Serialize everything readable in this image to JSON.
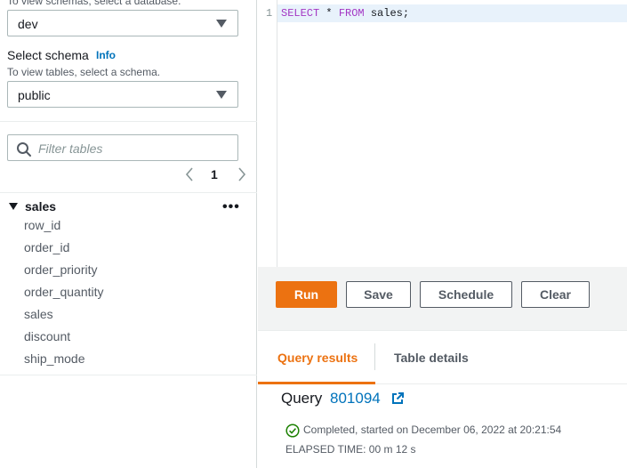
{
  "database": {
    "hint": "To view schemas, select a database.",
    "value": "dev"
  },
  "schema": {
    "label": "Select schema",
    "info": "Info",
    "hint": "To view tables, select a schema.",
    "value": "public"
  },
  "tables": {
    "filter_placeholder": "Filter tables",
    "page": "1",
    "tree": {
      "name": "sales",
      "columns": [
        "row_id",
        "order_id",
        "order_priority",
        "order_quantity",
        "sales",
        "discount",
        "ship_mode"
      ]
    }
  },
  "editor": {
    "line_number": "1",
    "kw1": "SELECT",
    "mid1": " * ",
    "kw2": "FROM",
    "rest": " sales;"
  },
  "toolbar": {
    "run": "Run",
    "save": "Save",
    "schedule": "Schedule",
    "clear": "Clear"
  },
  "tabs": {
    "results": "Query results",
    "details": "Table details"
  },
  "query": {
    "title": "Query",
    "id": "801094",
    "status": "Completed, started on December 06, 2022 at 20:21:54",
    "elapsed": "ELAPSED TIME: 00 m 12 s"
  },
  "colors": {
    "accent": "#ec7211",
    "link": "#0073bb",
    "success": "#1d8102"
  }
}
